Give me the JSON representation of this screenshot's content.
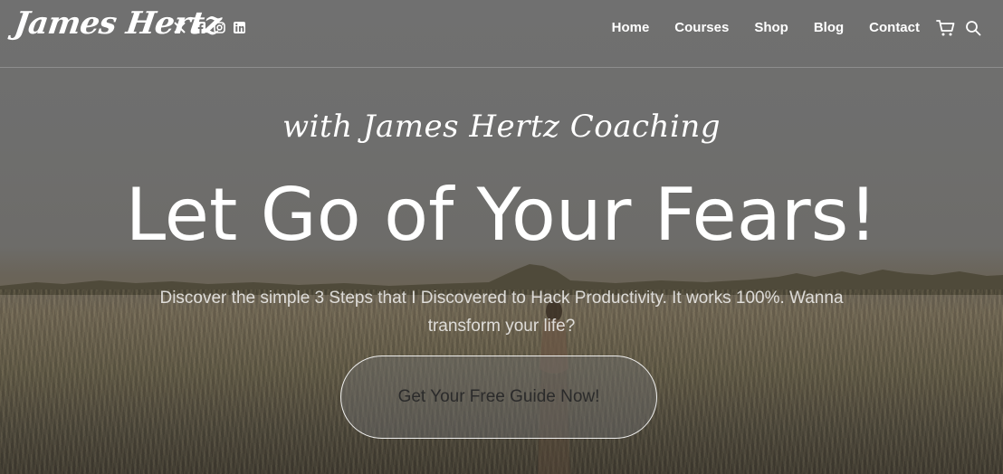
{
  "header": {
    "logo": "James Hertz",
    "socials": [
      {
        "icon": "x-twitter-icon",
        "glyph": "𝕏"
      },
      {
        "icon": "facebook-icon",
        "glyph": "f"
      },
      {
        "icon": "instagram-icon",
        "glyph": "◎"
      },
      {
        "icon": "linkedin-icon",
        "glyph": "in"
      }
    ],
    "nav": [
      "Home",
      "Courses",
      "Shop",
      "Blog",
      "Contact"
    ],
    "cart_icon": "cart-icon",
    "search_icon": "search-icon"
  },
  "hero": {
    "tagline": "with James Hertz Coaching",
    "headline": "Let Go of Your Fears!",
    "subtext": "Discover the simple 3 Steps that I Discovered to Hack Productivity. It works 100%. Wanna transform your life?",
    "cta_label": "Get Your Free Guide Now!"
  },
  "colors": {
    "text": "#ffffff",
    "cta_text": "#2b2b2b",
    "background": "#6e6c68"
  }
}
